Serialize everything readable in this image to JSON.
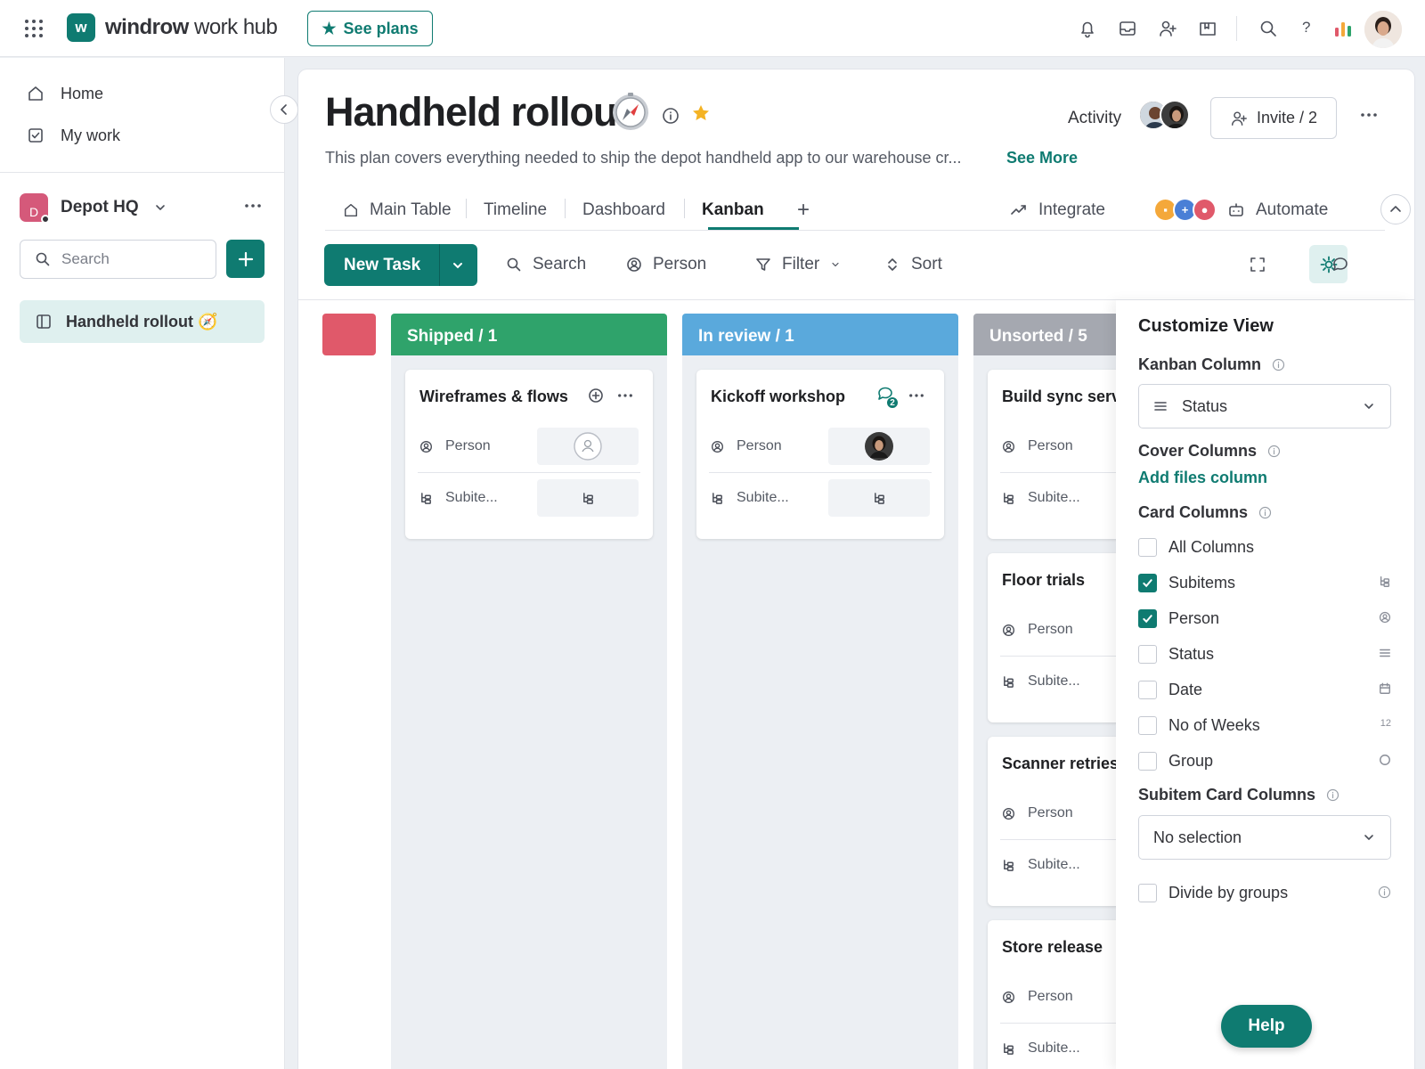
{
  "brand": {
    "bold": "windrow",
    "rest": " work hub"
  },
  "topbar": {
    "see_plans": "See plans"
  },
  "sidebar": {
    "nav": [
      {
        "label": "Home"
      },
      {
        "label": "My work"
      }
    ],
    "workspace": {
      "initial": "D",
      "name": "Depot HQ"
    },
    "search_placeholder": "Search",
    "board": "Handheld rollout 🧭"
  },
  "board": {
    "title": "Handheld rollout",
    "activity": "Activity",
    "invite": "Invite / 2",
    "description": "This plan covers everything needed to ship the depot handheld app to our warehouse cr...",
    "see_more": "See More",
    "tabs": [
      "Main Table",
      "Timeline",
      "Dashboard",
      "Kanban"
    ],
    "integrate": "Integrate",
    "automate": "Automate"
  },
  "toolbar": {
    "new_task": "New Task",
    "search": "Search",
    "person": "Person",
    "filter": "Filter",
    "sort": "Sort"
  },
  "columns": [
    {
      "label": "Shipped / 1",
      "color": "#2fa36b",
      "cards": [
        {
          "title": "Wireframes & flows"
        }
      ]
    },
    {
      "label": "In review / 1",
      "color": "#5aa9dc",
      "cards": [
        {
          "title": "Kickoff workshop",
          "comments": "2"
        }
      ]
    },
    {
      "label": "Unsorted / 5",
      "color": "#a5a8b0",
      "cards": [
        {
          "title": "Build sync service"
        },
        {
          "title": "Floor trials"
        },
        {
          "title": "Scanner retries"
        },
        {
          "title": "Store release"
        }
      ]
    }
  ],
  "card_fields": {
    "person": "Person",
    "subitems": "Subite..."
  },
  "customize": {
    "title": "Customize View",
    "kanban_column_label": "Kanban Column",
    "kanban_column_value": "Status",
    "cover_columns_label": "Cover Columns",
    "add_files": "Add files column",
    "card_columns_label": "Card Columns",
    "card_columns": [
      {
        "label": "All Columns",
        "checked": false,
        "icon": ""
      },
      {
        "label": "Subitems",
        "checked": true,
        "icon": "subitems-icon"
      },
      {
        "label": "Person",
        "checked": true,
        "icon": "person-icon"
      },
      {
        "label": "Status",
        "checked": false,
        "icon": "status-icon"
      },
      {
        "label": "Date",
        "checked": false,
        "icon": "calendar-icon"
      },
      {
        "label": "No of Weeks",
        "checked": false,
        "icon": "12"
      },
      {
        "label": "Group",
        "checked": false,
        "icon": "circle-icon"
      }
    ],
    "subitem_card_columns_label": "Subitem Card Columns",
    "subitem_card_columns_value": "No selection",
    "divide_by_groups": "Divide by groups"
  },
  "help": "Help",
  "colors": {
    "accent": "#0f7b71",
    "accent_light": "#dff0ef",
    "red_group": "#e0596a"
  }
}
